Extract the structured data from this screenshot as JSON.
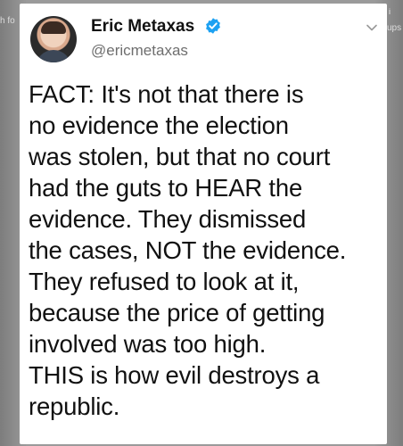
{
  "background": {
    "left_fragment": "h fo",
    "right_fragment": "ups",
    "right_icon": "i"
  },
  "tweet": {
    "author_name": "Eric Metaxas",
    "author_handle": "@ericmetaxas",
    "verified": true,
    "text": "FACT: It's not that there is\nno evidence the election\nwas stolen, but that no court\nhad the guts to HEAR the\nevidence. They dismissed\nthe cases, NOT the evidence.\nThey refused to look at it,\nbecause the price of getting\ninvolved was too high.\nTHIS is how evil destroys a\nrepublic."
  },
  "icons": {
    "avatar": "profile-photo",
    "verified": "verified-badge-icon",
    "menu": "chevron-down-icon"
  },
  "colors": {
    "verified_blue": "#1da1f2",
    "text": "#111111",
    "handle": "#6e6e6e"
  }
}
